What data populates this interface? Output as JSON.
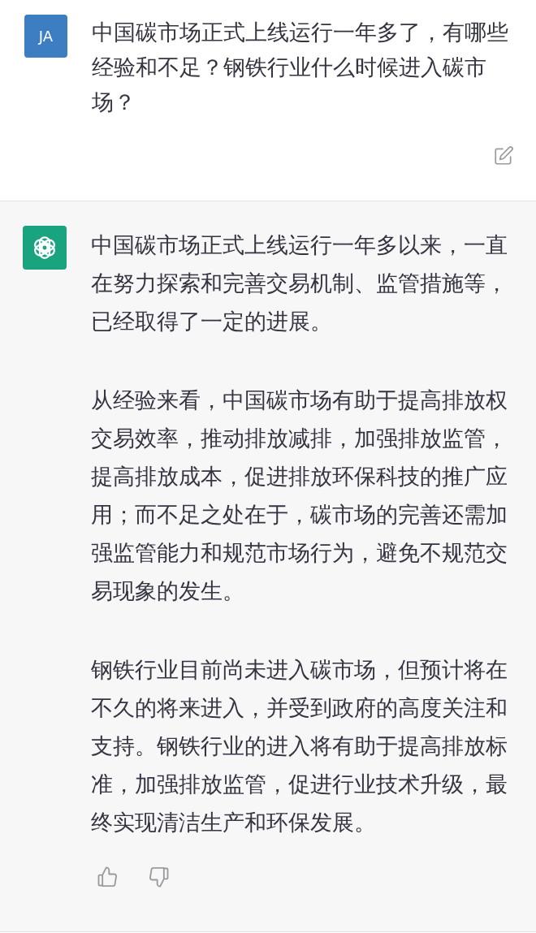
{
  "conversation": [
    {
      "kind": "user",
      "avatar": "JA",
      "paragraphs": [
        "中国碳市场正式上线运行一年多了，有哪些经验和不足？钢铁行业什么时候进入碳市场？"
      ]
    },
    {
      "kind": "assistant",
      "paragraphs": [
        "中国碳市场正式上线运行一年多以来，一直在努力探索和完善交易机制、监管措施等，已经取得了一定的进展。",
        "从经验来看，中国碳市场有助于提高排放权交易效率，推动排放减排，加强排放监管，提高排放成本，促进排放环保科技的推广应用；而不足之处在于，碳市场的完善还需加强监管能力和规范市场行为，避免不规范交易现象的发生。",
        "钢铁行业目前尚未进入碳市场，但预计将在不久的将来进入，并受到政府的高度关注和支持。钢铁行业的进入将有助于提高排放标准，加强排放监管，促进行业技术升级，最终实现清洁生产和环保发展。"
      ]
    }
  ]
}
